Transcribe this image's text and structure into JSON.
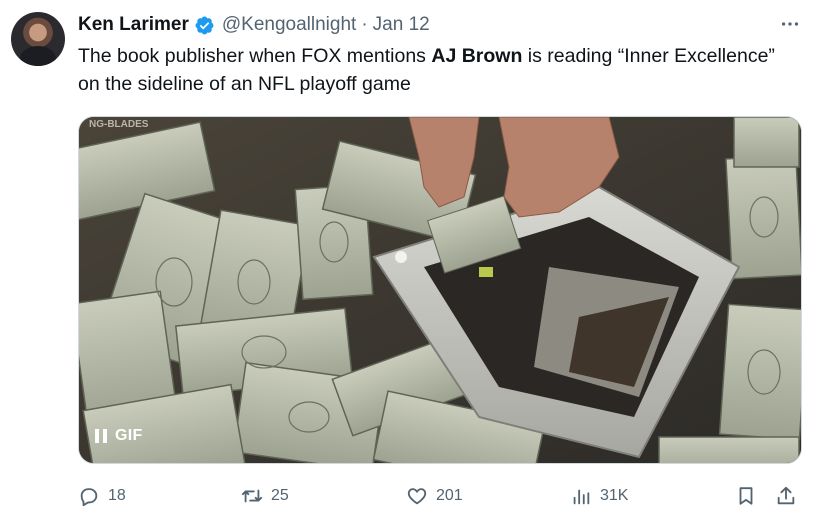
{
  "author": {
    "name": "Ken Larimer",
    "handle": "@Kengoallnight",
    "separator": "·",
    "date": "Jan 12",
    "verified_color": "#1d9bf0"
  },
  "tweet": {
    "text_before": "The book publisher when FOX mentions ",
    "text_bold": "AJ Brown",
    "text_after": " is reading “Inner Excellence” on the sideline of an NFL playoff game"
  },
  "media": {
    "badge": "GIF",
    "watermark": "NG-BLADES"
  },
  "actions": {
    "replies": "18",
    "reposts": "25",
    "likes": "201",
    "views": "31K"
  },
  "icons": {
    "more": "more-icon",
    "reply": "reply-icon",
    "repost": "repost-icon",
    "like": "heart-icon",
    "views": "views-icon",
    "bookmark": "bookmark-icon",
    "share": "share-icon",
    "pause": "pause-icon"
  }
}
